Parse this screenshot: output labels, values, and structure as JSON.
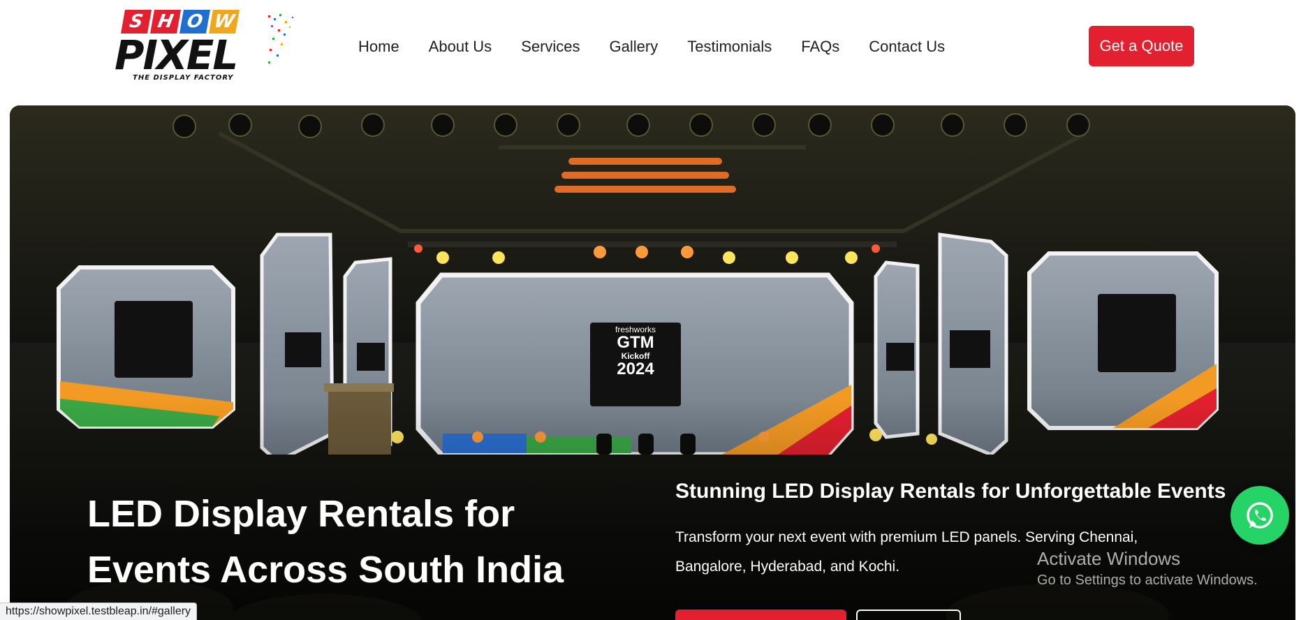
{
  "logo": {
    "tiles": [
      "S",
      "H",
      "O",
      "W"
    ],
    "tile_colors": [
      "#e3202f",
      "#e3202f",
      "#1f6fd1",
      "#f2a71b"
    ],
    "word": "PIXEL",
    "tagline": "THE DISPLAY FACTORY"
  },
  "nav": {
    "items": [
      "Home",
      "About Us",
      "Services",
      "Gallery",
      "Testimonials",
      "FAQs",
      "Contact Us"
    ]
  },
  "header": {
    "cta_label": "Get a Quote"
  },
  "hero": {
    "title_line1": "LED Display Rentals for",
    "title_line2": "Events Across South India",
    "subtitle": "Stunning LED Display Rentals for Unforgettable Events",
    "description": "Transform your next event with premium LED panels. Serving Chennai, Bangalore, Hyderabad, and Kochi.",
    "screen_brand": "freshworks",
    "screen_event": "GTM",
    "screen_sub": "Kickoff",
    "screen_year": "2024"
  },
  "overlay": {
    "activate_title": "Activate Windows",
    "activate_sub": "Go to Settings to activate Windows."
  },
  "status_bar": {
    "url": "https://showpixel.testbleap.in/#gallery"
  },
  "colors": {
    "accent": "#e3202f",
    "whatsapp": "#25d366"
  },
  "icons": {
    "whatsapp": "whatsapp-icon"
  }
}
